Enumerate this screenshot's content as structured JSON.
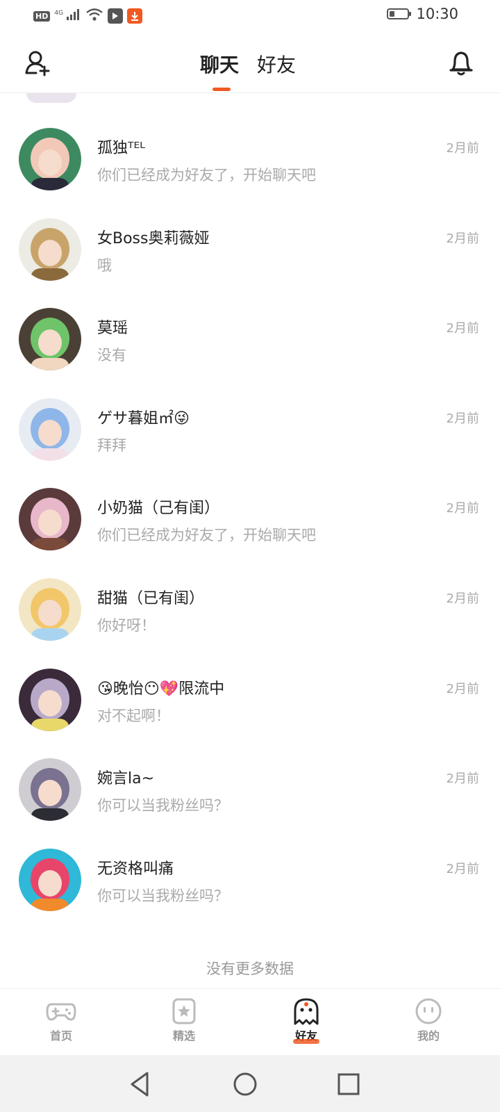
{
  "status_bar": {
    "hd": "HD",
    "network": "4G",
    "time": "10:30",
    "battery_level": 0.3
  },
  "header": {
    "tabs": [
      {
        "label": "聊天",
        "active": true
      },
      {
        "label": "好友",
        "active": false
      }
    ],
    "accent_color": "#f05a22",
    "icons": {
      "left": "add-friend-icon",
      "right": "bell-icon"
    }
  },
  "chats": [
    {
      "name": "孤独ᵀᴱᴸ",
      "preview": "你们已经成为好友了，开始聊天吧",
      "time": "2月前",
      "avatar_colors": [
        "#3e8a60",
        "#f2c9b8",
        "#2a2a3a"
      ]
    },
    {
      "name": "女Boss奥莉薇娅",
      "preview": "哦",
      "time": "2月前",
      "avatar_colors": [
        "#ecebe4",
        "#c9a46a",
        "#8a6a3c"
      ]
    },
    {
      "name": "莫瑶",
      "preview": "没有",
      "time": "2月前",
      "avatar_colors": [
        "#4a4036",
        "#6fc46a",
        "#f1d6c0"
      ]
    },
    {
      "name": "ゲサ暮姐㎡😜",
      "preview": "拜拜",
      "time": "2月前",
      "avatar_colors": [
        "#e7ecf3",
        "#8fb6e8",
        "#f2dfe8"
      ]
    },
    {
      "name": "小奶猫（己有闺）",
      "preview": "你们已经成为好友了，开始聊天吧",
      "time": "2月前",
      "avatar_colors": [
        "#5a3a3a",
        "#e8b7c9",
        "#7a4a3a"
      ]
    },
    {
      "name": "甜猫（已有闺）",
      "preview": "你好呀！",
      "time": "2月前",
      "avatar_colors": [
        "#f3e6c4",
        "#f2c76a",
        "#a9d4ef"
      ]
    },
    {
      "name": "😘晚怡😶💖限流中",
      "preview": "对不起啊！",
      "time": "2月前",
      "avatar_colors": [
        "#3a2a3a",
        "#b9a9c9",
        "#e8d86a"
      ]
    },
    {
      "name": "婉言la~",
      "preview": "你可以当我粉丝吗？",
      "time": "2月前",
      "avatar_colors": [
        "#cfcdd2",
        "#7a7290",
        "#2c2c34"
      ]
    },
    {
      "name": "无资格叫痛",
      "preview": "你可以当我粉丝吗？",
      "time": "2月前",
      "avatar_colors": [
        "#2fb8d8",
        "#e8456a",
        "#f08a2a"
      ]
    }
  ],
  "no_more_text": "没有更多数据",
  "bottom_tabs": [
    {
      "label": "首页",
      "icon": "gamepad-icon",
      "active": false
    },
    {
      "label": "精选",
      "icon": "star-badge-icon",
      "active": false
    },
    {
      "label": "好友",
      "icon": "ghost-icon",
      "active": true
    },
    {
      "label": "我的",
      "icon": "smiley-icon",
      "active": false
    }
  ],
  "system_nav": [
    "back-icon",
    "home-icon",
    "recents-icon"
  ]
}
